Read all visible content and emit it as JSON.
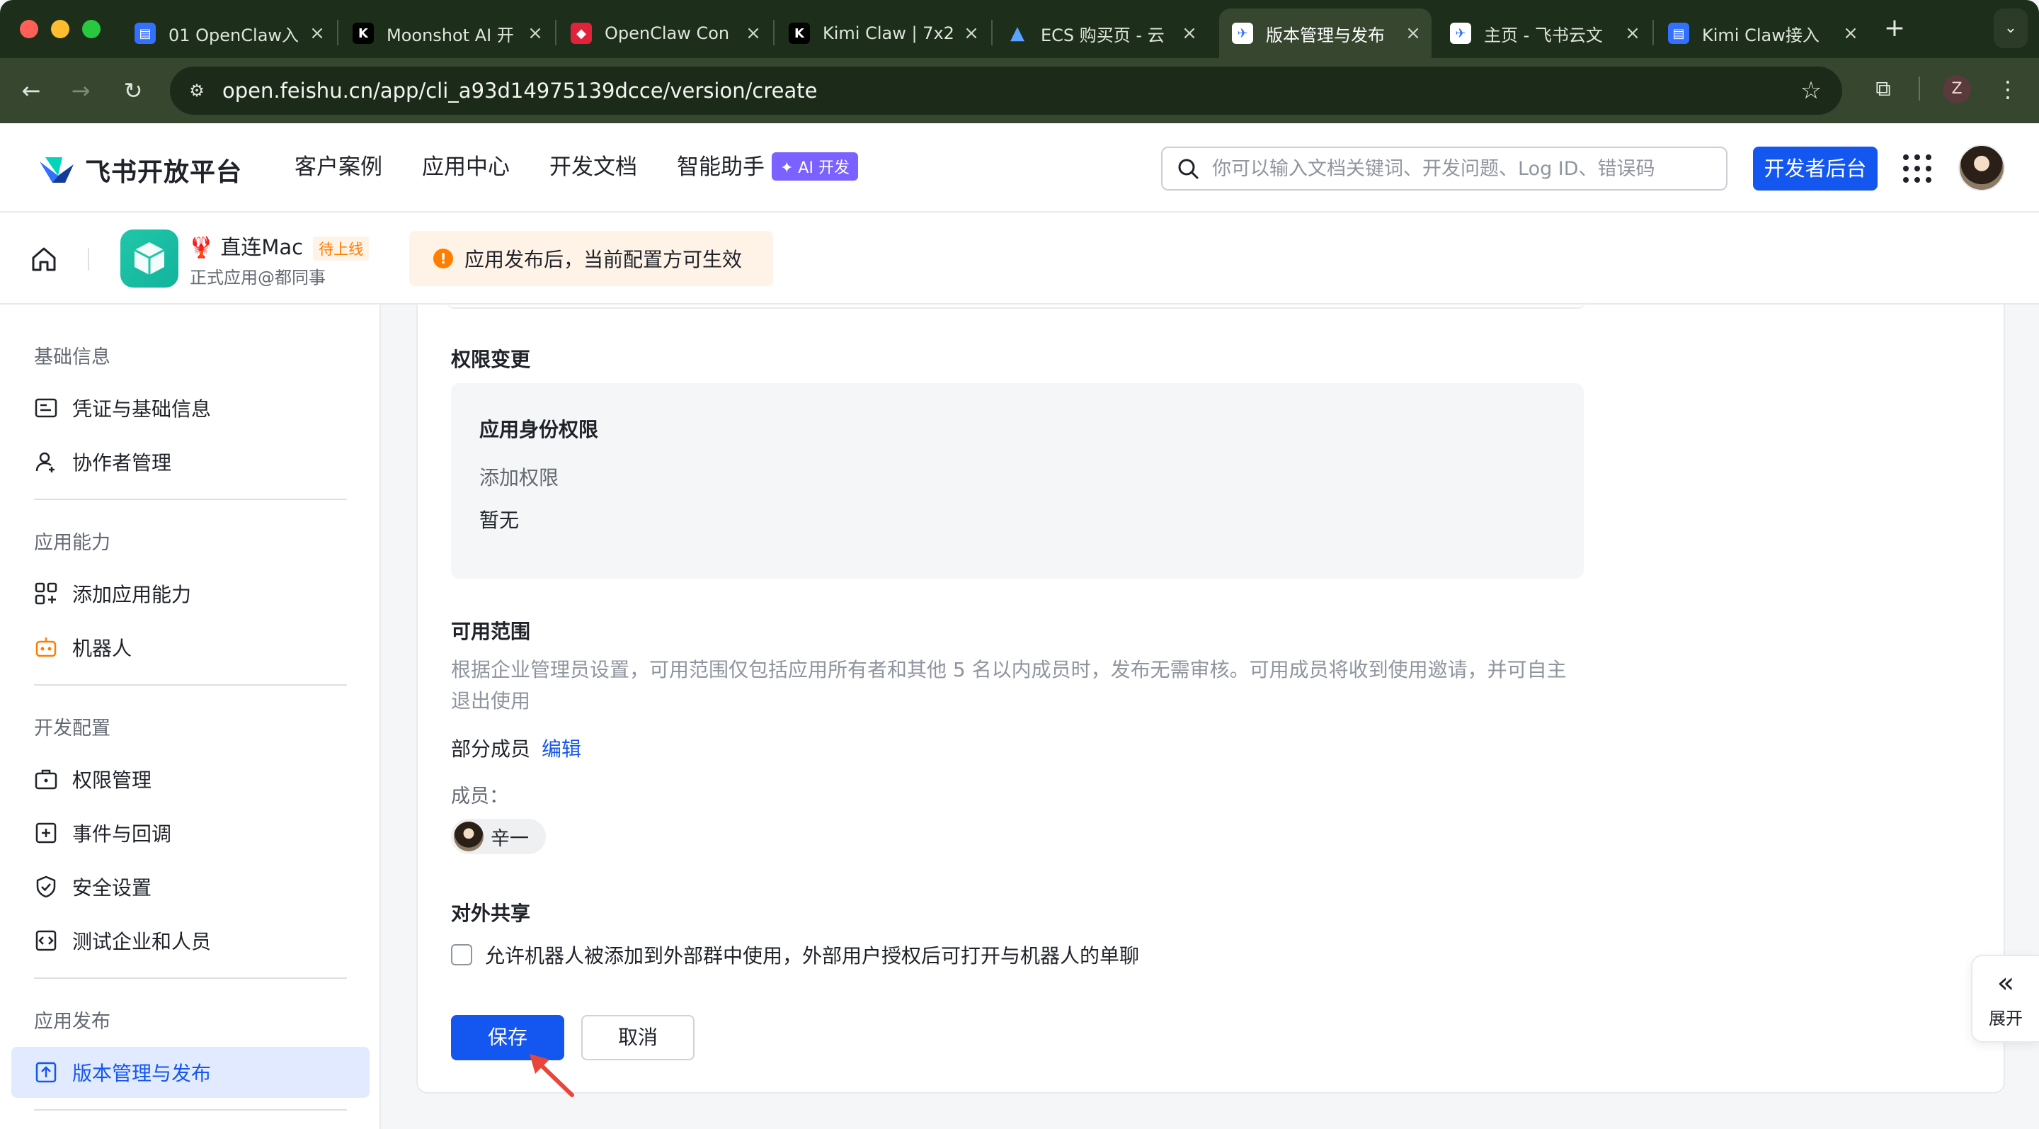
{
  "browser": {
    "tabs": [
      {
        "title": "01 OpenClaw入",
        "favicon": "doc-icon"
      },
      {
        "title": "Moonshot AI 开",
        "favicon": "kimi-icon"
      },
      {
        "title": "OpenClaw Con",
        "favicon": "ruby-icon"
      },
      {
        "title": "Kimi Claw | 7x2",
        "favicon": "kimi-icon"
      },
      {
        "title": "ECS 购买页 - 云",
        "favicon": "aliyun-icon"
      },
      {
        "title": "版本管理与发布",
        "favicon": "feishu-icon",
        "active": true
      },
      {
        "title": "主页 - 飞书云文",
        "favicon": "feishu-icon"
      },
      {
        "title": "Kimi Claw接入",
        "favicon": "doc-icon"
      }
    ],
    "url": "open.feishu.cn/app/cli_a93d14975139dcce/version/create",
    "profile_initial": "Z"
  },
  "header": {
    "logo_text": "飞书开放平台",
    "nav": [
      "客户案例",
      "应用中心",
      "开发文档",
      "智能助手"
    ],
    "ai_badge": "✦ AI 开发",
    "search_placeholder": "你可以输入文档关键词、开发问题、Log ID、错误码",
    "dev_console": "开发者后台"
  },
  "app_bar": {
    "app_name": "🦞 直连Mac",
    "app_status": "待上线",
    "app_sub": "正式应用@都同事",
    "notice": "应用发布后，当前配置方可生效"
  },
  "sidebar": {
    "groups": [
      {
        "label": "基础信息",
        "items": [
          "凭证与基础信息",
          "协作者管理"
        ]
      },
      {
        "label": "应用能力",
        "items": [
          "添加应用能力",
          "机器人"
        ]
      },
      {
        "label": "开发配置",
        "items": [
          "权限管理",
          "事件与回调",
          "安全设置",
          "测试企业和人员"
        ]
      },
      {
        "label": "应用发布",
        "items": [
          "版本管理与发布"
        ]
      }
    ],
    "active_item": "版本管理与发布"
  },
  "main": {
    "permission_section": {
      "title": "权限变更",
      "box_title": "应用身份权限",
      "added_label": "添加权限",
      "added_value": "暂无"
    },
    "scope_section": {
      "title": "可用范围",
      "description": "根据企业管理员设置，可用范围仅包括应用所有者和其他 5 名以内成员时，发布无需审核。可用成员将收到使用邀请，并可自主退出使用",
      "scope_value": "部分成员",
      "edit_label": "编辑",
      "members_label": "成员：",
      "members": [
        "辛一"
      ]
    },
    "share_section": {
      "title": "对外共享",
      "checkbox_label": "允许机器人被添加到外部群中使用，外部用户授权后可打开与机器人的单聊",
      "checked": false
    },
    "save_label": "保存",
    "cancel_label": "取消"
  },
  "expand_panel": {
    "chevron": "«",
    "label": "展开"
  },
  "colors": {
    "primary": "#1456f0",
    "warning": "#ff7d00",
    "active_bg": "#e1eaff",
    "annotation_arrow": "#e8463a"
  }
}
